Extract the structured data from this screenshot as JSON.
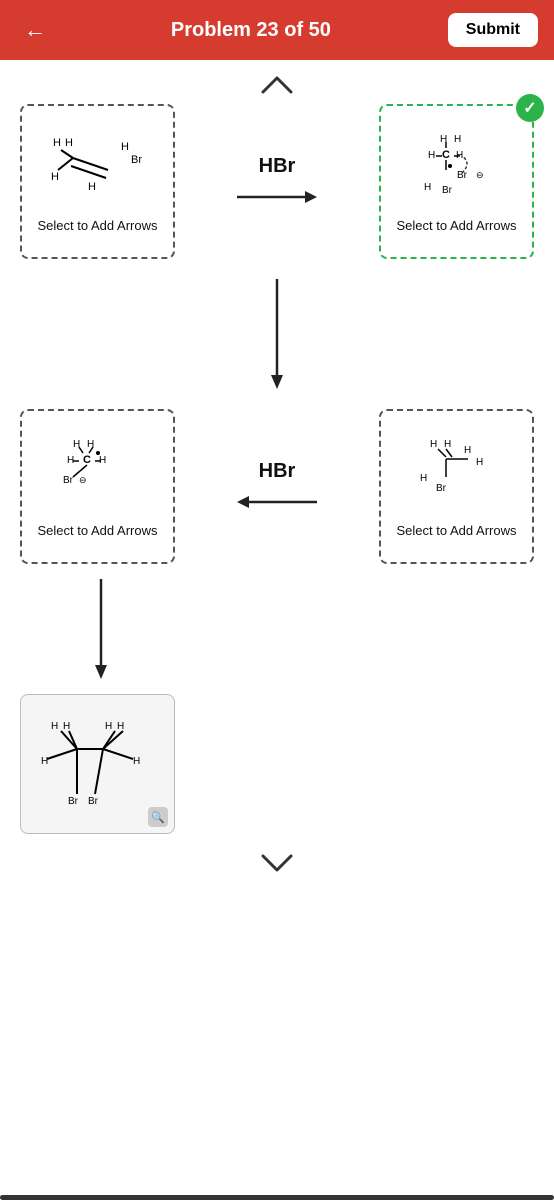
{
  "header": {
    "title": "Problem 23 of 50",
    "back_label": "←",
    "submit_label": "Submit"
  },
  "row1": {
    "reagent": "HBr",
    "select_arrows": "Select to Add Arrows"
  },
  "row2": {
    "reagent": "HBr",
    "select_arrows": "Select to Add Arrows"
  },
  "nav": {
    "up": "▲",
    "down": "▼"
  },
  "colors": {
    "header_bg": "#d63b2f",
    "green_border": "#2cb34a",
    "dashed_border": "#555"
  }
}
